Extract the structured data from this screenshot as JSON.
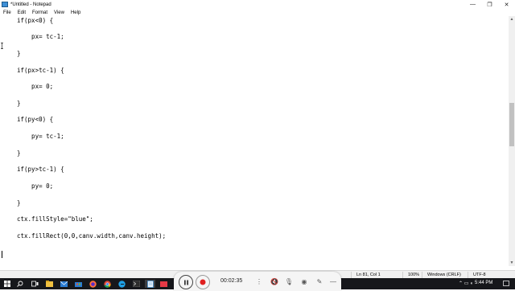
{
  "window": {
    "title": "*Untitled - Notepad",
    "controls": {
      "minimize": "—",
      "maximize": "❐",
      "close": "✕"
    }
  },
  "menu": [
    "File",
    "Edit",
    "Format",
    "View",
    "Help"
  ],
  "editor": {
    "lines": [
      "if(px<0) {",
      "    px= tc-1;",
      "}",
      "if(px>tc-1) {",
      "    px= 0;",
      "}",
      "if(py<0) {",
      "    py= tc-1;",
      "}",
      "if(py>tc-1) {",
      "    py= 0;",
      "}",
      "ctx.fillStyle=\"blue\";",
      "ctx.fillRect(0,0,canv.width,canv.height);"
    ]
  },
  "statusbar": {
    "position": "Ln 81, Col 1",
    "zoom": "100%",
    "line_ending": "Windows (CRLF)",
    "encoding": "UTF-8"
  },
  "recorder": {
    "time": "00:02:35"
  },
  "taskbar": {
    "clock": "5:44 PM",
    "colors": {
      "bg": "#16171b",
      "accent": "#0078d7"
    }
  }
}
